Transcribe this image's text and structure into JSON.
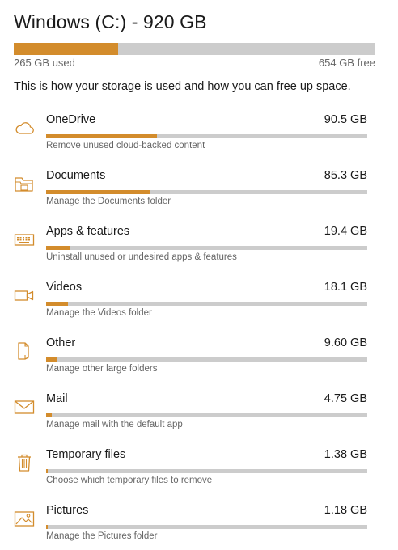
{
  "drive": {
    "title": "Windows (C:) - 920 GB",
    "used_label": "265 GB used",
    "free_label": "654 GB free",
    "used_fraction": 0.288,
    "description": "This is how your storage is used and how you can free up space."
  },
  "colors": {
    "accent": "#d38c2c",
    "track": "#cccccc"
  },
  "items": [
    {
      "name": "OneDrive",
      "size": "90.5 GB",
      "subtitle": "Remove unused cloud-backed content",
      "icon": "cloud-icon",
      "fraction": 0.344
    },
    {
      "name": "Documents",
      "size": "85.3 GB",
      "subtitle": "Manage the Documents folder",
      "icon": "folder-icon",
      "fraction": 0.322
    },
    {
      "name": "Apps & features",
      "size": "19.4 GB",
      "subtitle": "Uninstall unused or undesired apps & features",
      "icon": "keyboard-icon",
      "fraction": 0.073
    },
    {
      "name": "Videos",
      "size": "18.1 GB",
      "subtitle": "Manage the Videos folder",
      "icon": "video-camera-icon",
      "fraction": 0.068
    },
    {
      "name": "Other",
      "size": "9.60 GB",
      "subtitle": "Manage other large folders",
      "icon": "document-icon",
      "fraction": 0.036
    },
    {
      "name": "Mail",
      "size": "4.75 GB",
      "subtitle": "Manage mail with the default app",
      "icon": "mail-icon",
      "fraction": 0.018
    },
    {
      "name": "Temporary files",
      "size": "1.38 GB",
      "subtitle": "Choose which temporary files to remove",
      "icon": "trash-icon",
      "fraction": 0.005
    },
    {
      "name": "Pictures",
      "size": "1.18 GB",
      "subtitle": "Manage the Pictures folder",
      "icon": "picture-icon",
      "fraction": 0.004
    }
  ]
}
